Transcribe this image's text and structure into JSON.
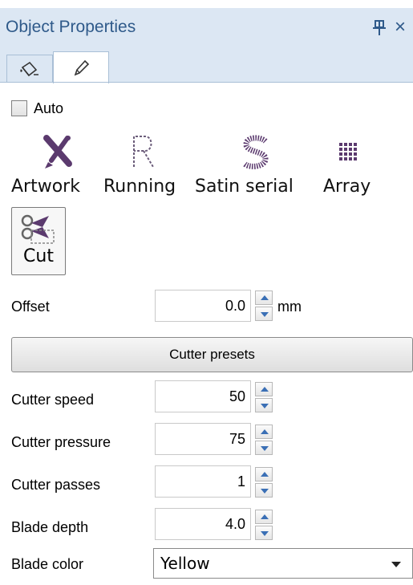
{
  "window": {
    "title": "Object Properties",
    "pin_icon": "pin-icon",
    "close_label": "×"
  },
  "tabs": [
    {
      "name": "fill-tab",
      "icon": "paint-bucket-icon"
    },
    {
      "name": "outline-tab",
      "icon": "pen-icon",
      "selected": true
    }
  ],
  "auto": {
    "label": "Auto",
    "checked": false
  },
  "object_types": [
    {
      "label": "Artwork",
      "icon": "artwork-icon"
    },
    {
      "label": "Running",
      "icon": "running-stitch-icon"
    },
    {
      "label": "Satin serial",
      "icon": "satin-serial-icon"
    },
    {
      "label": "Array",
      "icon": "array-icon"
    },
    {
      "label": "Cut",
      "icon": "scissors-icon",
      "selected": true
    }
  ],
  "offset": {
    "label": "Offset",
    "value": "0.0",
    "unit": "mm"
  },
  "cutter_presets": {
    "label": "Cutter presets"
  },
  "cutter_speed": {
    "label": "Cutter speed",
    "value": "50"
  },
  "cutter_pressure": {
    "label": "Cutter pressure",
    "value": "75"
  },
  "cutter_passes": {
    "label": "Cutter passes",
    "value": "1"
  },
  "blade_depth": {
    "label": "Blade depth",
    "value": "4.0"
  },
  "blade_color": {
    "label": "Blade color",
    "value": "Yellow"
  },
  "colors": {
    "titlebar_bg": "#dce7f3",
    "title_text": "#2f5a8a",
    "spin_arrow": "#3a6fb5",
    "icon_purple": "#5b3a6e"
  }
}
